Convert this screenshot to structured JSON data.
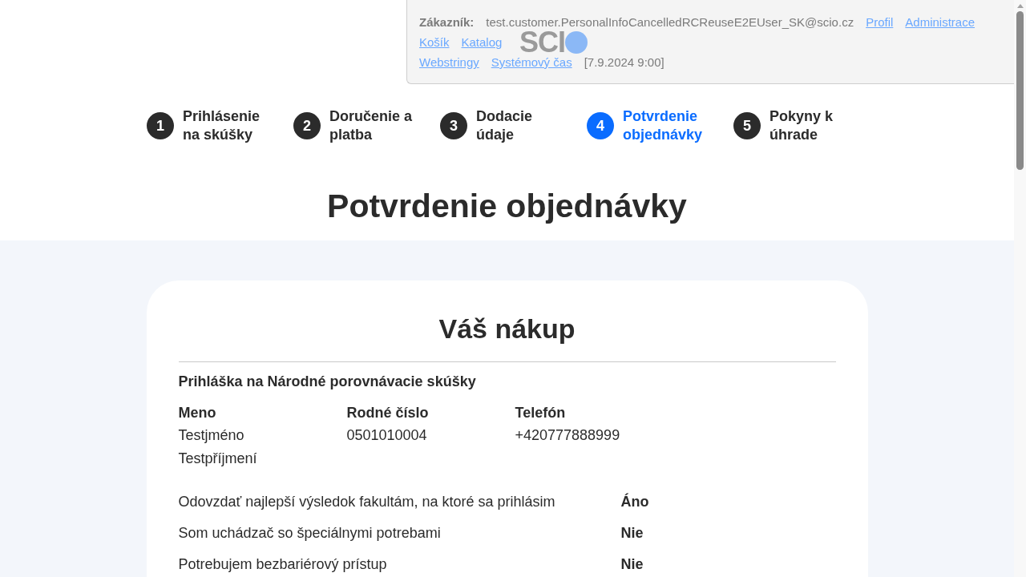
{
  "admin_panel": {
    "lines": [
      {
        "items": [
          {
            "kind": "label",
            "text": "Zákazník:"
          },
          {
            "kind": "text",
            "text": "test.customer.PersonalInfoCancelledRCReuseE2EUser_SK@scio.cz"
          },
          {
            "kind": "link",
            "text": "Profil"
          },
          {
            "kind": "link",
            "text": "Administrace"
          }
        ]
      },
      {
        "items": [
          {
            "kind": "link",
            "text": "Košík"
          },
          {
            "kind": "link",
            "text": "Katalog"
          }
        ]
      },
      {
        "items": [
          {
            "kind": "link",
            "text": "Webstringy"
          },
          {
            "kind": "link",
            "text": "Systémový čas"
          },
          {
            "kind": "text",
            "text": "[7.9.2024 9:00]"
          }
        ]
      }
    ]
  },
  "logo": {
    "text": "SCI"
  },
  "steps": [
    {
      "number": "1",
      "label": "Prihlásenie na skúšky",
      "selected": false
    },
    {
      "number": "2",
      "label": "Doručenie a platba",
      "selected": false
    },
    {
      "number": "3",
      "label": "Dodacie údaje",
      "selected": false
    },
    {
      "number": "4",
      "label": "Potvrdenie objednávky",
      "selected": true
    },
    {
      "number": "5",
      "label": "Pokyny k úhrade",
      "selected": false
    }
  ],
  "page_title": "Potvrdenie objednávky",
  "purchase": {
    "title": "Váš nákup",
    "product": "Prihláška na Národné porovnávacie skúšky",
    "columns": [
      {
        "heading": "Meno",
        "values": [
          "Testjméno",
          "Testpříjmení"
        ]
      },
      {
        "heading": "Rodné číslo",
        "values": [
          "0501010004"
        ]
      },
      {
        "heading": "Telefón",
        "values": [
          "+420777888999"
        ]
      }
    ],
    "details": [
      {
        "label": "Odovzdať najlepší výsledok fakultám, na ktoré sa prihlásim",
        "value": "Áno"
      },
      {
        "label": "Som uchádzač so špeciálnymi potrebami",
        "value": "Nie"
      },
      {
        "label": "Potrebujem bezbariérový prístup",
        "value": "Nie"
      }
    ]
  }
}
